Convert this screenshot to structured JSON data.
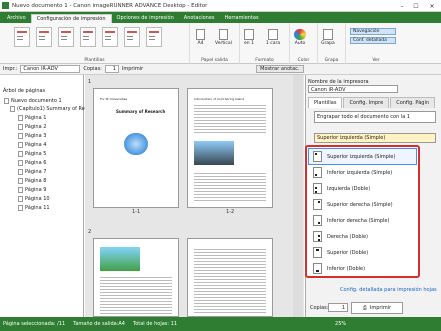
{
  "window": {
    "title": "Nuevo documento 1 - Canon imageRUNNER ADVANCE Desktop - Editor"
  },
  "ribbon_tabs": [
    "Archivo",
    "Configuración de impresión",
    "Opciones de impresión",
    "Anotaciones",
    "Herramientas"
  ],
  "ribbon": {
    "group_plantillas": "Plantillas",
    "btn_a4": "A4",
    "btn_vertical": "Vertical",
    "group_papel": "Papel salida",
    "btn_en1": "en 1",
    "btn_1cara": "1 cara",
    "group_formato": "Formato",
    "btn_auto": "Auto",
    "group_color": "Color",
    "btn_grapa": "Grapa",
    "group_grapa": "Grapa",
    "btn_navegacion": "Navegación",
    "btn_conf_detallada": "Conf. detallada",
    "group_ver": "Ver"
  },
  "toolbar": {
    "label_impr": "Impr.:",
    "printer": "Canon iR-ADV",
    "label_copias": "Copias:",
    "copies": "1",
    "imprimir": "Imprimir",
    "mostrar_anotac": "Mostrar anotac."
  },
  "tree": {
    "title": "Árbol de páginas",
    "root": "Nuevo documento 1",
    "chapter": "(Capítulo1) Summary of Re",
    "pages": [
      "Página 1",
      "Página 2",
      "Página 3",
      "Página 4",
      "Página 5",
      "Página 6",
      "Página 7",
      "Página 8",
      "Página 9",
      "Página 10",
      "Página 11"
    ]
  },
  "preview": {
    "sheet1_num": "1",
    "sheet2_num": "2",
    "label_1_1": "1-1",
    "label_1_2": "1-2",
    "doc_title": "Summary of Research",
    "doc_header": "For IR Universities",
    "doc_intro": "Introduction of Cold Spring Island"
  },
  "right": {
    "printer_label": "Nombre de la impresora",
    "printer": "Canon iR-ADV",
    "tabs": [
      "Plantillas",
      "Config. Impre",
      "Config. Págin"
    ],
    "engrapar": "Engrapar todo el documento con la 1",
    "selected": "Superior izquierda (Simple)",
    "options": [
      "Superior izquierda (Simple)",
      "Inferior izquierda (Simple)",
      "Izquierda (Doble)",
      "Superior derecha (Simple)",
      "Inferior derecha (Simple)",
      "Derecha (Doble)",
      "Superior (Doble)",
      "Inferior (Doble)"
    ],
    "link": "Config. detallada para impresión hojas",
    "copias_label": "Copias:",
    "copias": "1",
    "imprimir": "Imprimir"
  },
  "status": {
    "selected": "Página seleccionada: /11",
    "size": "Tamaño de salida:A4",
    "total": "Total de hojas: 11",
    "zoom": "25%"
  },
  "colors": {
    "brand_green": "#2e7d32",
    "highlight_red": "#d32f2f"
  }
}
